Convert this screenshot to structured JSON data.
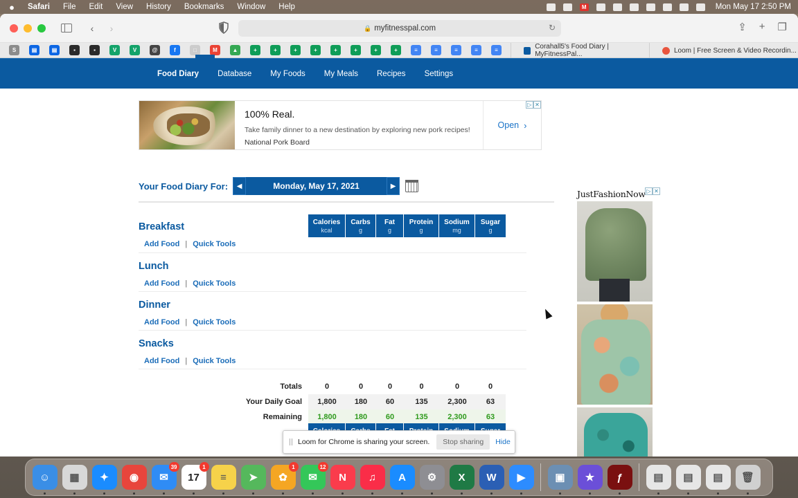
{
  "menubar": {
    "app": "Safari",
    "items": [
      "File",
      "Edit",
      "View",
      "History",
      "Bookmarks",
      "Window",
      "Help"
    ],
    "clock": "Mon May 17  2:50 PM"
  },
  "browser": {
    "url": "myfitnesspal.com",
    "tabs": [
      {
        "title": "Corahall5's Food Diary | MyFitnessPal...",
        "icon": "myfitnesspal-icon"
      },
      {
        "title": "Loom | Free Screen & Video Recordin...",
        "icon": "loom-icon"
      }
    ],
    "favorites": [
      {
        "icon": "s-icon",
        "color": "#8c8c8c",
        "glyph": "S"
      },
      {
        "icon": "trello-icon",
        "color": "#0c66e4",
        "glyph": "▤"
      },
      {
        "icon": "trello-icon",
        "color": "#0c66e4",
        "glyph": "▤"
      },
      {
        "icon": "dark-app-icon",
        "color": "#2b2b2b",
        "glyph": "▪"
      },
      {
        "icon": "dark-app-icon",
        "color": "#2b2b2b",
        "glyph": "▪"
      },
      {
        "icon": "v-icon",
        "color": "#14a36a",
        "glyph": "V"
      },
      {
        "icon": "v-icon",
        "color": "#14a36a",
        "glyph": "V"
      },
      {
        "icon": "at-icon",
        "color": "#444444",
        "glyph": "@"
      },
      {
        "icon": "facebook-icon",
        "color": "#1877f2",
        "glyph": "f"
      },
      {
        "icon": "page-icon",
        "color": "#cccccc",
        "glyph": "□"
      },
      {
        "icon": "gmail-icon",
        "color": "#ea4335",
        "glyph": "M"
      },
      {
        "icon": "drive-icon",
        "color": "#34a853",
        "glyph": "▲"
      },
      {
        "icon": "sheets-icon",
        "color": "#0f9d58",
        "glyph": "+"
      },
      {
        "icon": "sheets-icon",
        "color": "#0f9d58",
        "glyph": "+"
      },
      {
        "icon": "sheets-icon",
        "color": "#0f9d58",
        "glyph": "+"
      },
      {
        "icon": "sheets-icon",
        "color": "#0f9d58",
        "glyph": "+"
      },
      {
        "icon": "sheets-icon",
        "color": "#0f9d58",
        "glyph": "+"
      },
      {
        "icon": "sheets-icon",
        "color": "#0f9d58",
        "glyph": "+"
      },
      {
        "icon": "sheets-icon",
        "color": "#0f9d58",
        "glyph": "+"
      },
      {
        "icon": "sheets-icon",
        "color": "#0f9d58",
        "glyph": "+"
      },
      {
        "icon": "docs-icon",
        "color": "#4285f4",
        "glyph": "≡"
      },
      {
        "icon": "docs-icon",
        "color": "#4285f4",
        "glyph": "≡"
      },
      {
        "icon": "docs-icon",
        "color": "#4285f4",
        "glyph": "≡"
      },
      {
        "icon": "docs-icon",
        "color": "#4285f4",
        "glyph": "≡"
      },
      {
        "icon": "docs-icon",
        "color": "#4285f4",
        "glyph": "≡"
      }
    ]
  },
  "site_nav": {
    "items": [
      "Food Diary",
      "Database",
      "My Foods",
      "My Meals",
      "Recipes",
      "Settings"
    ],
    "active": "Food Diary"
  },
  "ad_top": {
    "title": "100% Real.",
    "description": "Take family dinner to a new destination by exploring new pork recipes!",
    "sponsor": "National Pork Board",
    "cta": "Open"
  },
  "diary": {
    "label": "Your Food Diary For:",
    "date": "Monday, May 17, 2021",
    "columns": [
      {
        "name": "Calories",
        "unit": "kcal"
      },
      {
        "name": "Carbs",
        "unit": "g"
      },
      {
        "name": "Fat",
        "unit": "g"
      },
      {
        "name": "Protein",
        "unit": "g"
      },
      {
        "name": "Sodium",
        "unit": "mg"
      },
      {
        "name": "Sugar",
        "unit": "g"
      }
    ],
    "meals": [
      {
        "name": "Breakfast",
        "add": "Add Food",
        "tools": "Quick Tools"
      },
      {
        "name": "Lunch",
        "add": "Add Food",
        "tools": "Quick Tools"
      },
      {
        "name": "Dinner",
        "add": "Add Food",
        "tools": "Quick Tools"
      },
      {
        "name": "Snacks",
        "add": "Add Food",
        "tools": "Quick Tools"
      }
    ],
    "totals": {
      "label": "Totals",
      "values": [
        "0",
        "0",
        "0",
        "0",
        "0",
        "0"
      ]
    },
    "goal": {
      "label": "Your Daily Goal",
      "values": [
        "1,800",
        "180",
        "60",
        "135",
        "2,300",
        "63"
      ]
    },
    "remaining": {
      "label": "Remaining",
      "values": [
        "1,800",
        "180",
        "60",
        "135",
        "2,300",
        "63"
      ],
      "color": "#2e9a1c"
    }
  },
  "side_ad": {
    "brand": "JustFashionNow"
  },
  "loom_bar": {
    "message": "Loom for Chrome is sharing your screen.",
    "stop": "Stop sharing",
    "hide": "Hide"
  },
  "dock": {
    "apps": [
      {
        "icon": "finder-icon",
        "color": "#3a8ee6",
        "glyph": "☺"
      },
      {
        "icon": "launchpad-icon",
        "color": "#d8d8d8",
        "glyph": "▦"
      },
      {
        "icon": "safari-icon",
        "color": "#1a8cff",
        "glyph": "✦"
      },
      {
        "icon": "chrome-icon",
        "color": "#e8453c",
        "glyph": "◉"
      },
      {
        "icon": "mail-icon",
        "color": "#2f8cf5",
        "glyph": "✉",
        "badge": "39"
      },
      {
        "icon": "calendar-icon",
        "color": "#ffffff",
        "glyph": "17",
        "badge": "1"
      },
      {
        "icon": "notes-icon",
        "color": "#f6d24a",
        "glyph": "≡"
      },
      {
        "icon": "maps-icon",
        "color": "#55b85c",
        "glyph": "➤"
      },
      {
        "icon": "photos-icon",
        "color": "#f5a623",
        "glyph": "✿",
        "badge": "1"
      },
      {
        "icon": "messages-icon",
        "color": "#34c759",
        "glyph": "✉",
        "badge": "12"
      },
      {
        "icon": "news-icon",
        "color": "#fa3c4c",
        "glyph": "N"
      },
      {
        "icon": "music-icon",
        "color": "#fa2d48",
        "glyph": "♫"
      },
      {
        "icon": "app-store-icon",
        "color": "#1a8cff",
        "glyph": "A"
      },
      {
        "icon": "system-preferences-icon",
        "color": "#8e8e93",
        "glyph": "⚙"
      },
      {
        "icon": "excel-icon",
        "color": "#1f7a45",
        "glyph": "X"
      },
      {
        "icon": "word-icon",
        "color": "#2b5fb4",
        "glyph": "W"
      },
      {
        "icon": "zoom-icon",
        "color": "#2d8cff",
        "glyph": "▶"
      },
      {
        "icon": "preview-icon",
        "color": "#6c8fb3",
        "glyph": "▣"
      },
      {
        "icon": "imovie-icon",
        "color": "#6b4fd8",
        "glyph": "★"
      },
      {
        "icon": "flash-icon",
        "color": "#7a1010",
        "glyph": "ƒ"
      },
      {
        "icon": "screenshot-icon",
        "color": "#e6e6e6",
        "glyph": "▤"
      },
      {
        "icon": "document-icon",
        "color": "#e6e6e6",
        "glyph": "▤"
      },
      {
        "icon": "document-icon",
        "color": "#e6e6e6",
        "glyph": "▤"
      },
      {
        "icon": "trash-icon",
        "color": "#d0d0d0",
        "glyph": "🗑"
      }
    ]
  }
}
